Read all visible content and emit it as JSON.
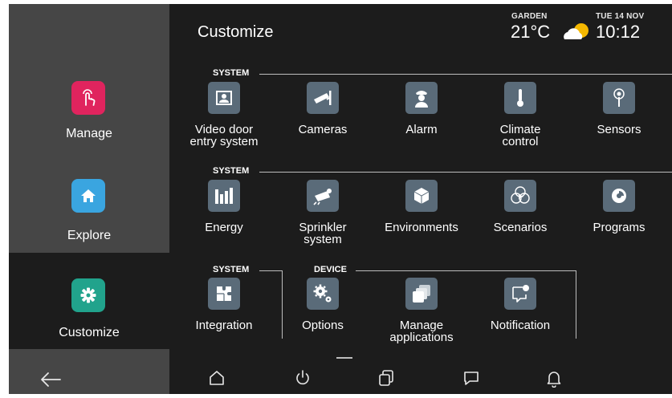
{
  "header": {
    "title": "Customize",
    "weather_location": "GARDEN",
    "temperature": "21°C",
    "date": "TUE 14 NOV",
    "time": "10:12"
  },
  "sidebar": {
    "items": [
      {
        "label": "Manage",
        "icon": "touch-hand-icon",
        "color": "#e0245e"
      },
      {
        "label": "Explore",
        "icon": "home-icon",
        "color": "#3aa5e0"
      },
      {
        "label": "Customize",
        "icon": "gear-icon",
        "color": "#21a38c",
        "active": true
      }
    ],
    "back_icon": "back-arrow-icon"
  },
  "sections": [
    {
      "label": "SYSTEM",
      "tiles": [
        {
          "label": "Video door entry system",
          "line1": "Video door",
          "line2": "entry system",
          "icon": "video-door-icon"
        },
        {
          "label": "Cameras",
          "icon": "camera-icon"
        },
        {
          "label": "Alarm",
          "icon": "guard-icon"
        },
        {
          "label": "Climate control",
          "line1": "Climate",
          "line2": "control",
          "icon": "thermometer-icon"
        },
        {
          "label": "Sensors",
          "icon": "sensor-icon"
        }
      ]
    },
    {
      "label": "SYSTEM",
      "tiles": [
        {
          "label": "Energy",
          "icon": "energy-bars-icon"
        },
        {
          "label": "Sprinkler system",
          "line1": "Sprinkler",
          "line2": "system",
          "icon": "sprinkler-icon"
        },
        {
          "label": "Environments",
          "icon": "cube-icon"
        },
        {
          "label": "Scenarios",
          "icon": "scenario-play-icon"
        },
        {
          "label": "Programs",
          "icon": "program-clock-icon"
        }
      ]
    },
    {
      "label": "SYSTEM",
      "tiles": [
        {
          "label": "Integration",
          "icon": "puzzle-icon"
        }
      ]
    },
    {
      "label": "DEVICE",
      "tiles": [
        {
          "label": "Options",
          "icon": "gears-icon"
        },
        {
          "label": "Manage applications",
          "line1": "Manage",
          "line2": "applications",
          "icon": "stacked-squares-icon"
        },
        {
          "label": "Notification",
          "icon": "notification-bubble-icon"
        }
      ]
    }
  ],
  "bottom_nav": [
    {
      "icon": "home-outline-icon"
    },
    {
      "icon": "power-icon"
    },
    {
      "icon": "multiwindow-icon"
    },
    {
      "icon": "message-icon"
    },
    {
      "icon": "bell-icon"
    }
  ],
  "colors": {
    "background": "#1c1c1c",
    "sidebar": "#464646",
    "tile_icon": "#5a6b79"
  }
}
